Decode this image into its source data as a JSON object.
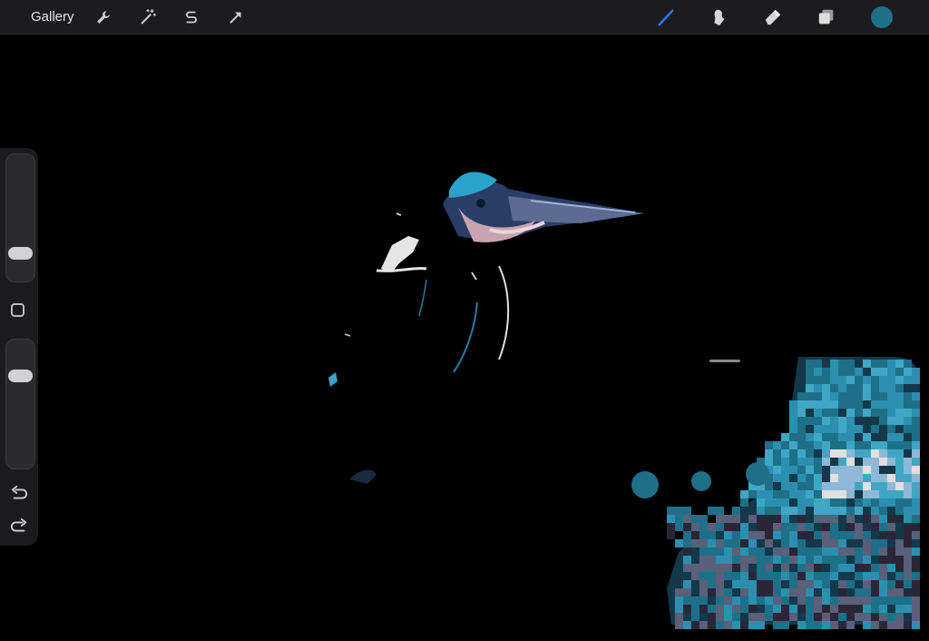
{
  "toolbar": {
    "gallery_label": "Gallery",
    "left_icons": [
      "wrench-icon",
      "magic-wand-icon",
      "selection-s-icon",
      "transform-arrow-icon"
    ],
    "right_icons": [
      "brush-icon",
      "smudge-icon",
      "eraser-icon",
      "layers-icon"
    ],
    "active_tool": "brush",
    "active_tool_color": "#2f7cf6",
    "current_color": "#1e7088"
  },
  "sidebar": {
    "brush_size_level": 0.18,
    "opacity_level": 0.75,
    "controls": [
      "brush-size-slider",
      "modify-button",
      "opacity-slider",
      "undo-icon",
      "redo-icon"
    ]
  },
  "canvas": {
    "background": "#000000",
    "palette": [
      "#1e7088",
      "#2c8fb0",
      "#3fa7c4",
      "#8fb8d6",
      "#5a5f7a",
      "#e0e0e0"
    ]
  }
}
